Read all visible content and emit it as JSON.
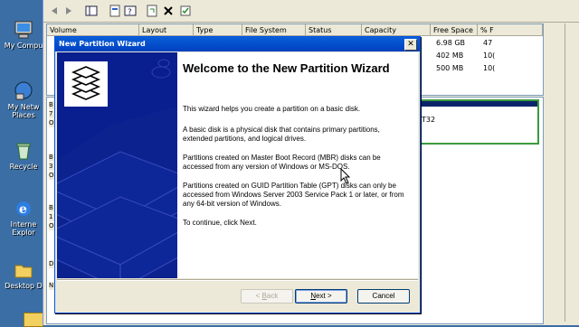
{
  "desktop": {
    "icons": [
      {
        "name": "my-computer",
        "label_lines": [
          "My Compu"
        ]
      },
      {
        "name": "my-network-places",
        "label_lines": [
          "My Netw",
          "Places"
        ]
      },
      {
        "name": "recycle-bin",
        "label_lines": [
          "Recycle"
        ]
      },
      {
        "name": "internet-explorer",
        "label_lines": [
          "Interne",
          "Explor"
        ]
      },
      {
        "name": "desktop",
        "label_lines": [
          "Desktop D"
        ]
      }
    ]
  },
  "disk_management": {
    "columns": [
      "Volume",
      "Layout",
      "Type",
      "File System",
      "Status",
      "Capacity",
      "Free Space",
      "% F"
    ],
    "rows": [
      {
        "free_space": "6.98 GB",
        "pct": "47 "
      },
      {
        "free_space": "402 MB",
        "pct": "10("
      },
      {
        "free_space": "500 MB",
        "pct": "10("
      }
    ],
    "volume_fragment": "T32",
    "disk_fragments": [
      "B",
      "7",
      "O",
      "B",
      "3",
      "O",
      "B",
      "1",
      "O",
      "D",
      "N"
    ]
  },
  "wizard": {
    "title": "New Partition Wizard",
    "close_glyph": "✕",
    "heading": "Welcome to the New Partition Wizard",
    "paragraphs": [
      "This wizard helps you create a partition on a basic disk.",
      "A basic disk is a physical disk that contains primary partitions, extended partitions, and logical drives.",
      "Partitions created on Master Boot Record (MBR) disks can be accessed from any version of Windows or MS-DOS.",
      "Partitions created on GUID Partition Table (GPT) disks can only be accessed from Windows Server 2003 Service Pack 1 or later, or from any 64-bit version of Windows.",
      "To continue, click Next."
    ],
    "buttons": {
      "back": {
        "prefix": "< ",
        "mnemonic": "B",
        "rest": "ack",
        "enabled": false
      },
      "next": {
        "prefix": "",
        "mnemonic": "N",
        "rest": "ext >",
        "enabled": true
      },
      "cancel": {
        "label": "Cancel",
        "enabled": true
      }
    }
  },
  "colors": {
    "desktop": "#3a6ea5",
    "title_bar": "#0a5fd8",
    "side_panel": "#0a1f8f",
    "window_face": "#ece9d8"
  }
}
